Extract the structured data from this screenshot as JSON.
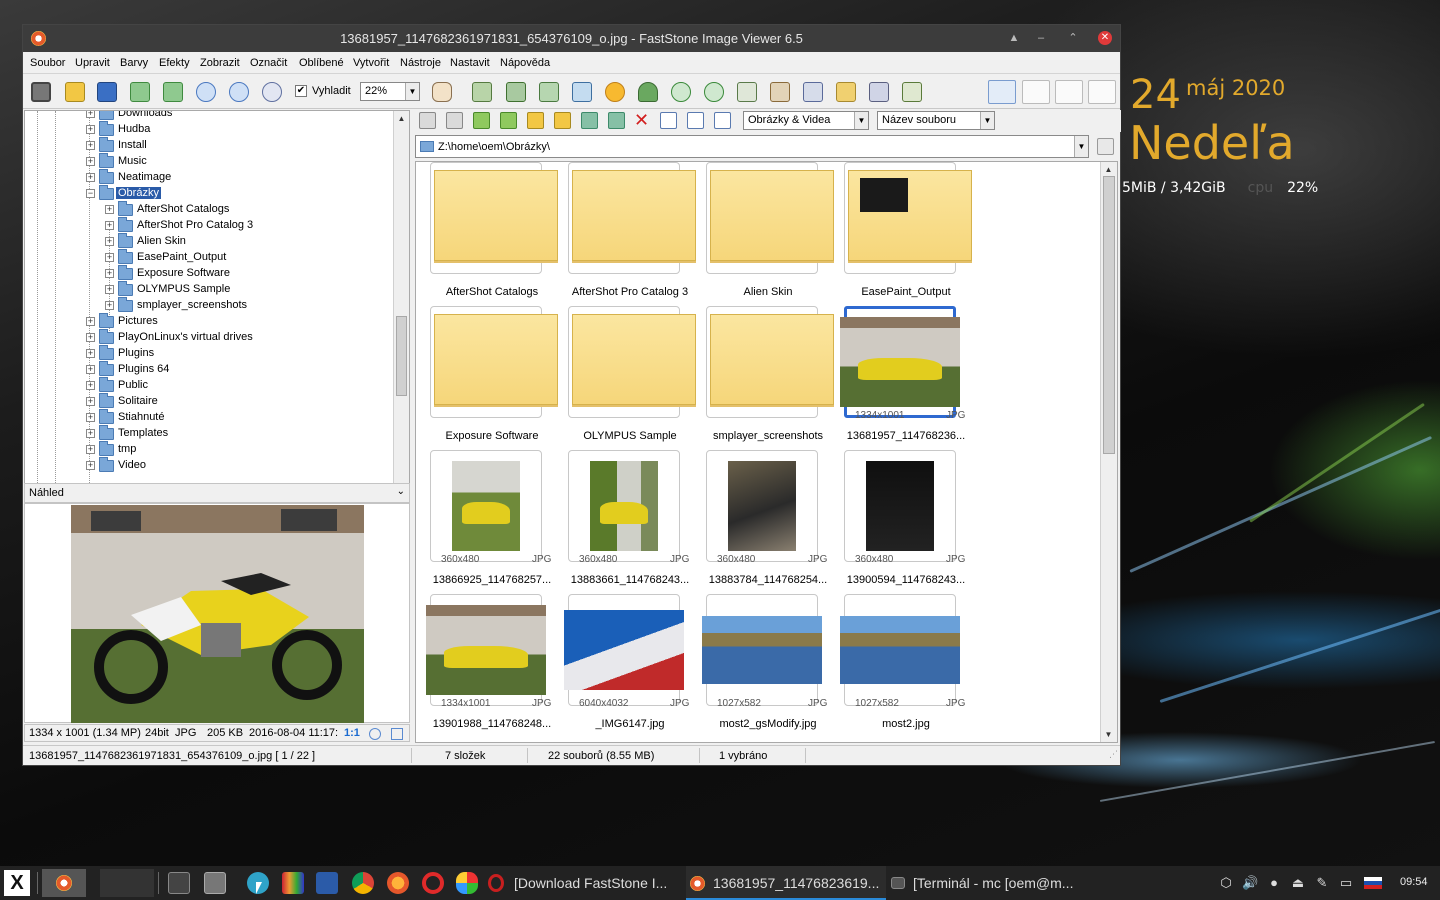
{
  "window": {
    "title": "13681957_1147682361971831_654376109_o.jpg - FastStone Image Viewer 6.5",
    "controls": [
      "▲",
      "–",
      "⌃",
      "✕"
    ]
  },
  "menu": [
    "Soubor",
    "Upravit",
    "Barvy",
    "Efekty",
    "Zobrazit",
    "Označit",
    "Oblíbené",
    "Vytvořit",
    "Nástroje",
    "Nastavit",
    "Nápověda"
  ],
  "toolbar": {
    "fit_label": "Vyhladit",
    "fit_checked": "✔",
    "zoom_value": "22%"
  },
  "nav": {
    "filter_value": "Obrázky & Videa",
    "sort_value": "Název souboru",
    "path": "Z:\\home\\oem\\Obrázky\\"
  },
  "tree": {
    "items": [
      {
        "label": "Downloads",
        "exp": "+"
      },
      {
        "label": "Hudba",
        "exp": "+"
      },
      {
        "label": "Install",
        "exp": "+"
      },
      {
        "label": "Music",
        "exp": "+"
      },
      {
        "label": "Neatimage",
        "exp": "+"
      },
      {
        "label": "Obrázky",
        "exp": "−"
      },
      {
        "label": "AfterShot Catalogs",
        "exp": "+"
      },
      {
        "label": "AfterShot Pro Catalog 3",
        "exp": "+"
      },
      {
        "label": "Alien Skin",
        "exp": "+"
      },
      {
        "label": "EasePaint_Output",
        "exp": "+"
      },
      {
        "label": "Exposure Software",
        "exp": "+"
      },
      {
        "label": "OLYMPUS Sample",
        "exp": "+"
      },
      {
        "label": "smplayer_screenshots",
        "exp": "+"
      },
      {
        "label": "Pictures",
        "exp": "+"
      },
      {
        "label": "PlayOnLinux's virtual drives",
        "exp": "+"
      },
      {
        "label": "Plugins",
        "exp": "+"
      },
      {
        "label": "Plugins 64",
        "exp": "+"
      },
      {
        "label": "Public",
        "exp": "+"
      },
      {
        "label": "Solitaire",
        "exp": "+"
      },
      {
        "label": "Stiahnuté",
        "exp": "+"
      },
      {
        "label": "Templates",
        "exp": "+"
      },
      {
        "label": "tmp",
        "exp": "+"
      },
      {
        "label": "Video",
        "exp": "+"
      }
    ]
  },
  "preview": {
    "title": "Náhled",
    "info": {
      "dims": "1334 x 1001 (1.34 MP)",
      "bits": "24bit",
      "format": "JPG",
      "size": "205 KB",
      "date": "2016-08-04 11:17:",
      "ratio": "1:1"
    }
  },
  "thumbs": [
    {
      "name": "AfterShot Catalogs"
    },
    {
      "name": "AfterShot Pro Catalog 3"
    },
    {
      "name": "Alien Skin"
    },
    {
      "name": "EasePaint_Output"
    },
    {
      "name": "Exposure Software"
    },
    {
      "name": "OLYMPUS Sample"
    },
    {
      "name": "smplayer_screenshots"
    },
    {
      "name": "13681957_114768236...",
      "dims": "1334x1001",
      "fmt": "JPG"
    },
    {
      "name": "13866925_114768257...",
      "dims": "360x480",
      "fmt": "JPG"
    },
    {
      "name": "13883661_114768243...",
      "dims": "360x480",
      "fmt": "JPG"
    },
    {
      "name": "13883784_114768254...",
      "dims": "360x480",
      "fmt": "JPG"
    },
    {
      "name": "13900594_114768243...",
      "dims": "360x480",
      "fmt": "JPG"
    },
    {
      "name": "13901988_114768248...",
      "dims": "1334x1001",
      "fmt": "JPG"
    },
    {
      "name": "_IMG6147.jpg",
      "dims": "6040x4032",
      "fmt": "JPG"
    },
    {
      "name": "most2_gsModify.jpg",
      "dims": "1027x582",
      "fmt": "JPG"
    },
    {
      "name": "most2.jpg",
      "dims": "1027x582",
      "fmt": "JPG"
    }
  ],
  "status": {
    "file": "13681957_1147682361971831_654376109_o.jpg [ 1 / 22 ]",
    "folders": "7 složek",
    "files": "22 souborů (8.55 MB)",
    "selected": "1 vybráno"
  },
  "desktop": {
    "day": "24",
    "month_year": "máj 2020",
    "weekday": "Nedeľa",
    "memory": "5MiB / 3,42GiB",
    "cpu_label": "cpu",
    "cpu_value": "22%"
  },
  "taskbar": {
    "start": "X",
    "tasks": [
      "[Download FastStone I...",
      "13681957_11476823619...",
      "[Terminál - mc [oem@m..."
    ],
    "clock": "09:54"
  }
}
